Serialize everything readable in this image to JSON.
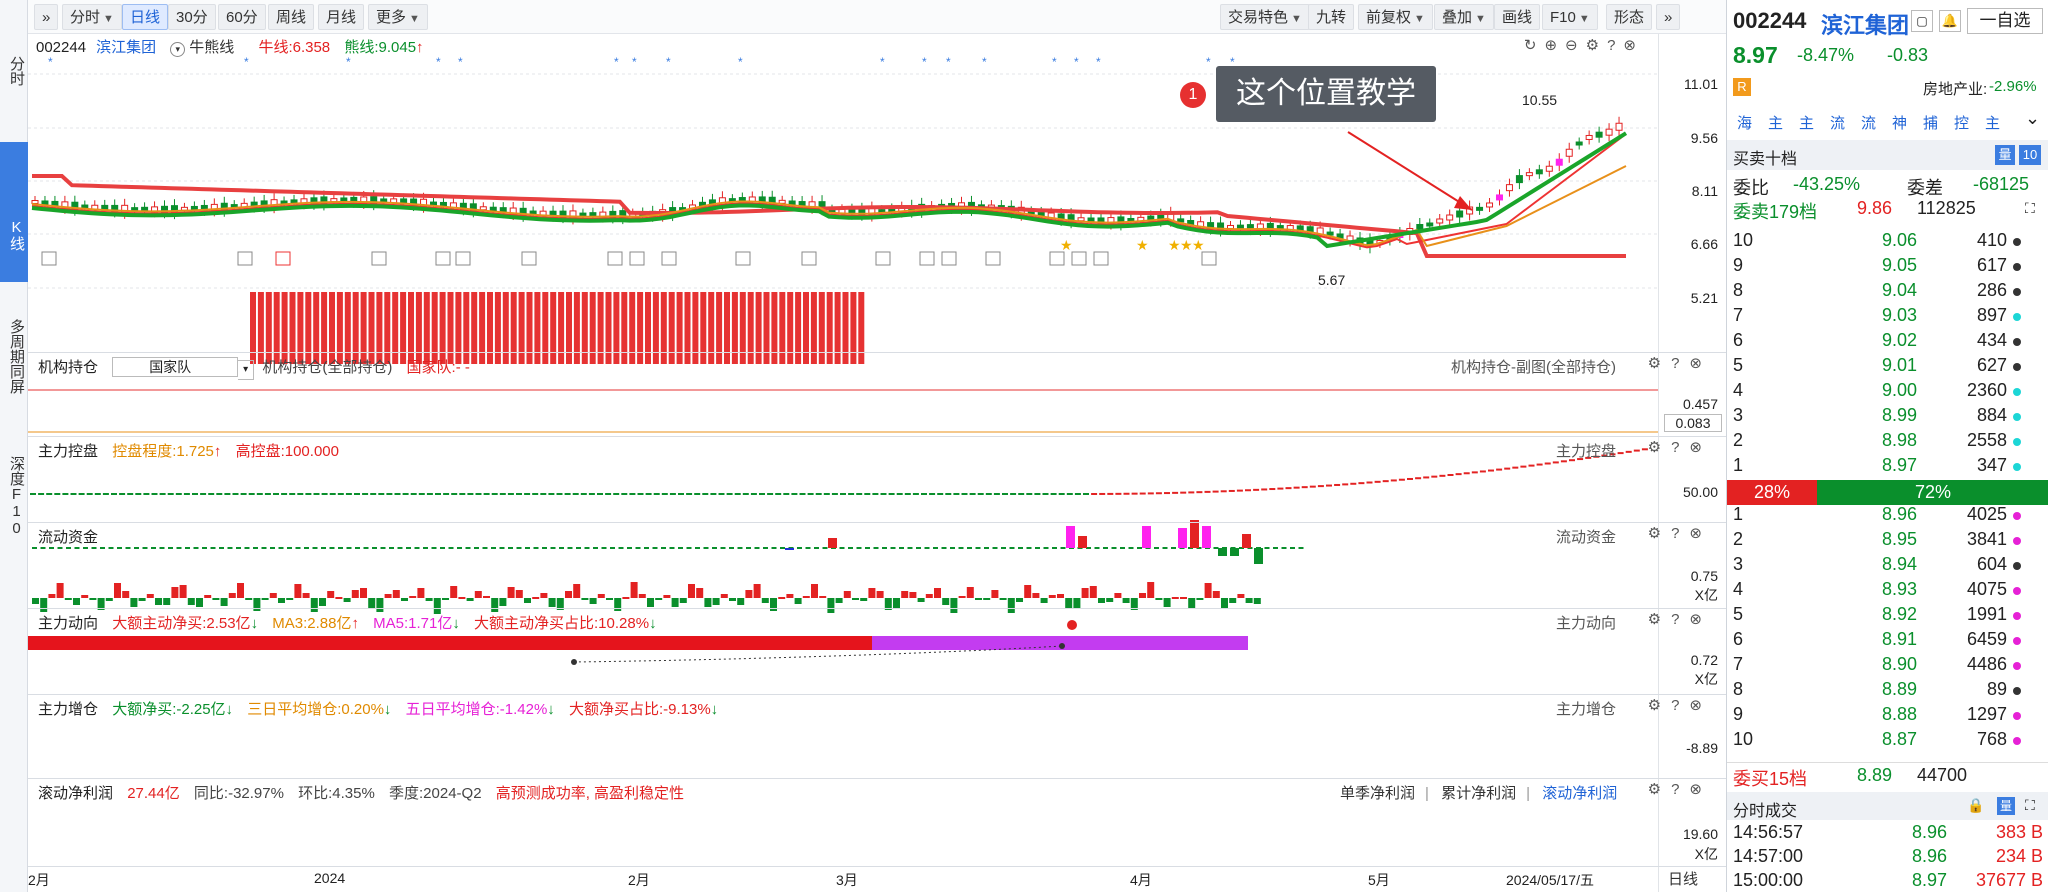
{
  "left_nav": [
    {
      "label": "分时",
      "active": false
    },
    {
      "label": "K线",
      "active": true
    },
    {
      "label": "多周期同屏",
      "active": false
    },
    {
      "label": "深度F10",
      "active": false
    }
  ],
  "toolbar": {
    "left": [
      {
        "label": "»",
        "caret": false,
        "active": false
      },
      {
        "label": "分时",
        "caret": true,
        "active": false
      },
      {
        "label": "日线",
        "caret": false,
        "active": true
      },
      {
        "label": "30分",
        "caret": false,
        "active": false
      },
      {
        "label": "60分",
        "caret": false,
        "active": false
      },
      {
        "label": "周线",
        "caret": false,
        "active": false
      },
      {
        "label": "月线",
        "caret": false,
        "active": false
      },
      {
        "label": "更多",
        "caret": true,
        "active": false
      }
    ],
    "right": [
      {
        "label": "交易特色",
        "caret": true
      },
      {
        "label": "九转",
        "caret": false
      },
      {
        "label": "前复权",
        "caret": true
      },
      {
        "label": "叠加",
        "caret": true
      },
      {
        "label": "画线",
        "caret": false
      },
      {
        "label": "F10",
        "caret": true
      },
      {
        "label": "形态",
        "caret": false
      },
      {
        "label": "»",
        "caret": false
      }
    ]
  },
  "kline_header": {
    "code": "002244",
    "name": "滨江集团",
    "indicator": "牛熊线",
    "bull_line": "牛线:6.358",
    "bear_line": "熊线:9.045",
    "high_label": "10.55",
    "low_label": "5.67"
  },
  "annotation": {
    "badge": "1",
    "text": "这个位置教学"
  },
  "price_axis": [
    "11.01",
    "9.56",
    "8.11",
    "6.66",
    "5.21"
  ],
  "panels": {
    "holding": {
      "title": "机构持仓",
      "select": "国家队",
      "sub1": "机构持仓(全部持仓)",
      "sub2": "国家队:-  -",
      "right_label": "机构持仓-副图(全部持仓)",
      "axis_top": "0.457",
      "axis_val": "0.083"
    },
    "control": {
      "title": "主力控盘",
      "level": "控盘程度:1.725",
      "high": "高控盘:100.000",
      "right_label": "主力控盘",
      "axis": "50.00"
    },
    "liquid": {
      "title": "流动资金",
      "right_label": "流动资金",
      "axis1": "0.75",
      "axis2": "X亿"
    },
    "trend": {
      "title": "主力动向",
      "big_net": "大额主动净买:2.53亿",
      "ma3": "MA3:2.88亿",
      "ma5": "MA5:1.71亿",
      "ratio": "大额主动净买占比:10.28%",
      "right_label": "主力动向",
      "axis1": "0.72",
      "axis2": "X亿"
    },
    "increase": {
      "title": "主力增仓",
      "big_net": "大额净买:-2.25亿",
      "three_day": "三日平均增仓:0.20%",
      "five_day": "五日平均增仓:-1.42%",
      "ratio": "大额净买占比:-9.13%",
      "right_label": "主力增仓",
      "axis": "-8.89"
    },
    "profit": {
      "title": "滚动净利润",
      "value": "27.44亿",
      "yoy": "同比:-32.97%",
      "qoq": "环比:4.35%",
      "season": "季度:2024-Q2",
      "desc": "高预测成功率, 高盈利稳定性",
      "tabs": [
        "单季净利润",
        "累计净利润",
        "滚动净利润"
      ],
      "axis1": "19.60",
      "axis2": "X亿"
    }
  },
  "x_axis": [
    "2月",
    "2024",
    "2月",
    "3月",
    "4月",
    "5月",
    "2024/05/17/五"
  ],
  "period_label": "日线",
  "quote": {
    "code": "002244",
    "name": "滨江集团",
    "self_select": "一自选",
    "price": "8.97",
    "change_pct": "-8.47%",
    "change": "-0.83",
    "r_badge": "R",
    "sector": "房地产业:",
    "sector_pct": "-2.96%",
    "tags": [
      "海",
      "主",
      "主",
      "流",
      "流",
      "神",
      "捕",
      "控",
      "主"
    ],
    "book_title": "买卖十档",
    "qty_label": "量",
    "qty_num": "10",
    "weibi_label": "委比",
    "weibi": "-43.25%",
    "weicha_label": "委差",
    "weicha": "-68125",
    "ask_total_label": "委卖179档",
    "ask_total_price": "9.86",
    "ask_total_vol": "112825",
    "bid_pct": "28%",
    "ask_pct": "72%",
    "bid_total_label": "委买15档",
    "bid_total_price": "8.89",
    "bid_total_vol": "44700",
    "trades_title": "分时成交"
  },
  "asks": [
    {
      "lvl": "10",
      "price": "9.06",
      "vol": "410",
      "dot": "#333"
    },
    {
      "lvl": "9",
      "price": "9.05",
      "vol": "617",
      "dot": "#333"
    },
    {
      "lvl": "8",
      "price": "9.04",
      "vol": "286",
      "dot": "#333"
    },
    {
      "lvl": "7",
      "price": "9.03",
      "vol": "897",
      "dot": "#1cd6d6"
    },
    {
      "lvl": "6",
      "price": "9.02",
      "vol": "434",
      "dot": "#333"
    },
    {
      "lvl": "5",
      "price": "9.01",
      "vol": "627",
      "dot": "#333"
    },
    {
      "lvl": "4",
      "price": "9.00",
      "vol": "2360",
      "dot": "#1cd6d6"
    },
    {
      "lvl": "3",
      "price": "8.99",
      "vol": "884",
      "dot": "#1cd6d6"
    },
    {
      "lvl": "2",
      "price": "8.98",
      "vol": "2558",
      "dot": "#1cd6d6"
    },
    {
      "lvl": "1",
      "price": "8.97",
      "vol": "347",
      "dot": "#1cd6d6"
    }
  ],
  "bids": [
    {
      "lvl": "1",
      "price": "8.96",
      "vol": "4025",
      "dot": "#e621d6"
    },
    {
      "lvl": "2",
      "price": "8.95",
      "vol": "3841",
      "dot": "#e621d6"
    },
    {
      "lvl": "3",
      "price": "8.94",
      "vol": "604",
      "dot": "#333"
    },
    {
      "lvl": "4",
      "price": "8.93",
      "vol": "4075",
      "dot": "#e621d6"
    },
    {
      "lvl": "5",
      "price": "8.92",
      "vol": "1991",
      "dot": "#e621d6"
    },
    {
      "lvl": "6",
      "price": "8.91",
      "vol": "6459",
      "dot": "#e621d6"
    },
    {
      "lvl": "7",
      "price": "8.90",
      "vol": "4486",
      "dot": "#e621d6"
    },
    {
      "lvl": "8",
      "price": "8.89",
      "vol": "89",
      "dot": "#333"
    },
    {
      "lvl": "9",
      "price": "8.88",
      "vol": "1297",
      "dot": "#e621d6"
    },
    {
      "lvl": "10",
      "price": "8.87",
      "vol": "768",
      "dot": "#e621d6"
    }
  ],
  "trades": [
    {
      "time": "14:56:57",
      "price": "8.96",
      "vol": "383 B"
    },
    {
      "time": "14:57:00",
      "price": "8.96",
      "vol": "234 B"
    },
    {
      "time": "15:00:00",
      "price": "8.97",
      "vol": "37677 B"
    }
  ],
  "colors": {
    "up": "#e32222",
    "down": "#0a8f2c",
    "accent": "#3b7de0",
    "magenta": "#ff22ee"
  }
}
